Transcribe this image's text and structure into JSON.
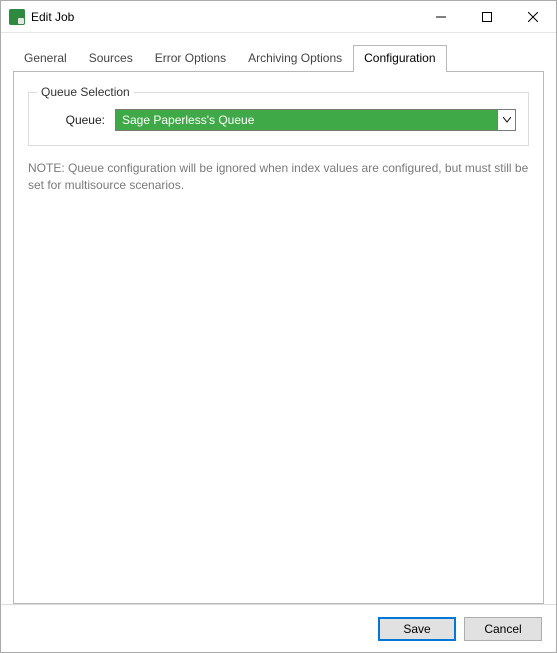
{
  "window": {
    "title": "Edit Job"
  },
  "tabs": [
    {
      "label": "General"
    },
    {
      "label": "Sources"
    },
    {
      "label": "Error Options"
    },
    {
      "label": "Archiving Options"
    },
    {
      "label": "Configuration"
    }
  ],
  "config": {
    "group_title": "Queue Selection",
    "queue_label": "Queue:",
    "queue_value": "Sage Paperless's Queue",
    "note": "NOTE: Queue configuration will be ignored when index values are configured, but must still be set for multisource scenarios."
  },
  "buttons": {
    "save": "Save",
    "cancel": "Cancel"
  }
}
